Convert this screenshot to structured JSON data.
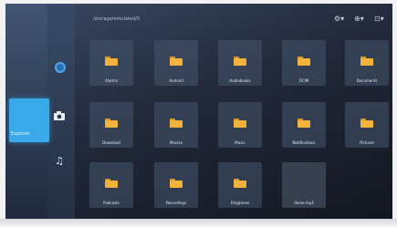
{
  "header": {
    "path": "/storage/emulated/0"
  },
  "top_icons": [
    "settings-icon",
    "search-icon",
    "tools-icon"
  ],
  "side": {
    "active_category": "Explorer"
  },
  "rail_icons": [
    "globe-icon",
    "camera-icon",
    "music-icon"
  ],
  "folders": [
    {
      "label": "Alarms"
    },
    {
      "label": "Android"
    },
    {
      "label": "Audiobooks"
    },
    {
      "label": "DCIM"
    },
    {
      "label": "Documents"
    },
    {
      "label": "Download"
    },
    {
      "label": "Movies"
    },
    {
      "label": "Music"
    },
    {
      "label": "Notifications"
    },
    {
      "label": "Pictures"
    },
    {
      "label": "Podcasts"
    },
    {
      "label": "Recordings"
    },
    {
      "label": "Ringtones"
    },
    {
      "label": "demo.mp4"
    }
  ],
  "colors": {
    "accent": "#3aa9e8",
    "folder": "#f2b23c"
  }
}
